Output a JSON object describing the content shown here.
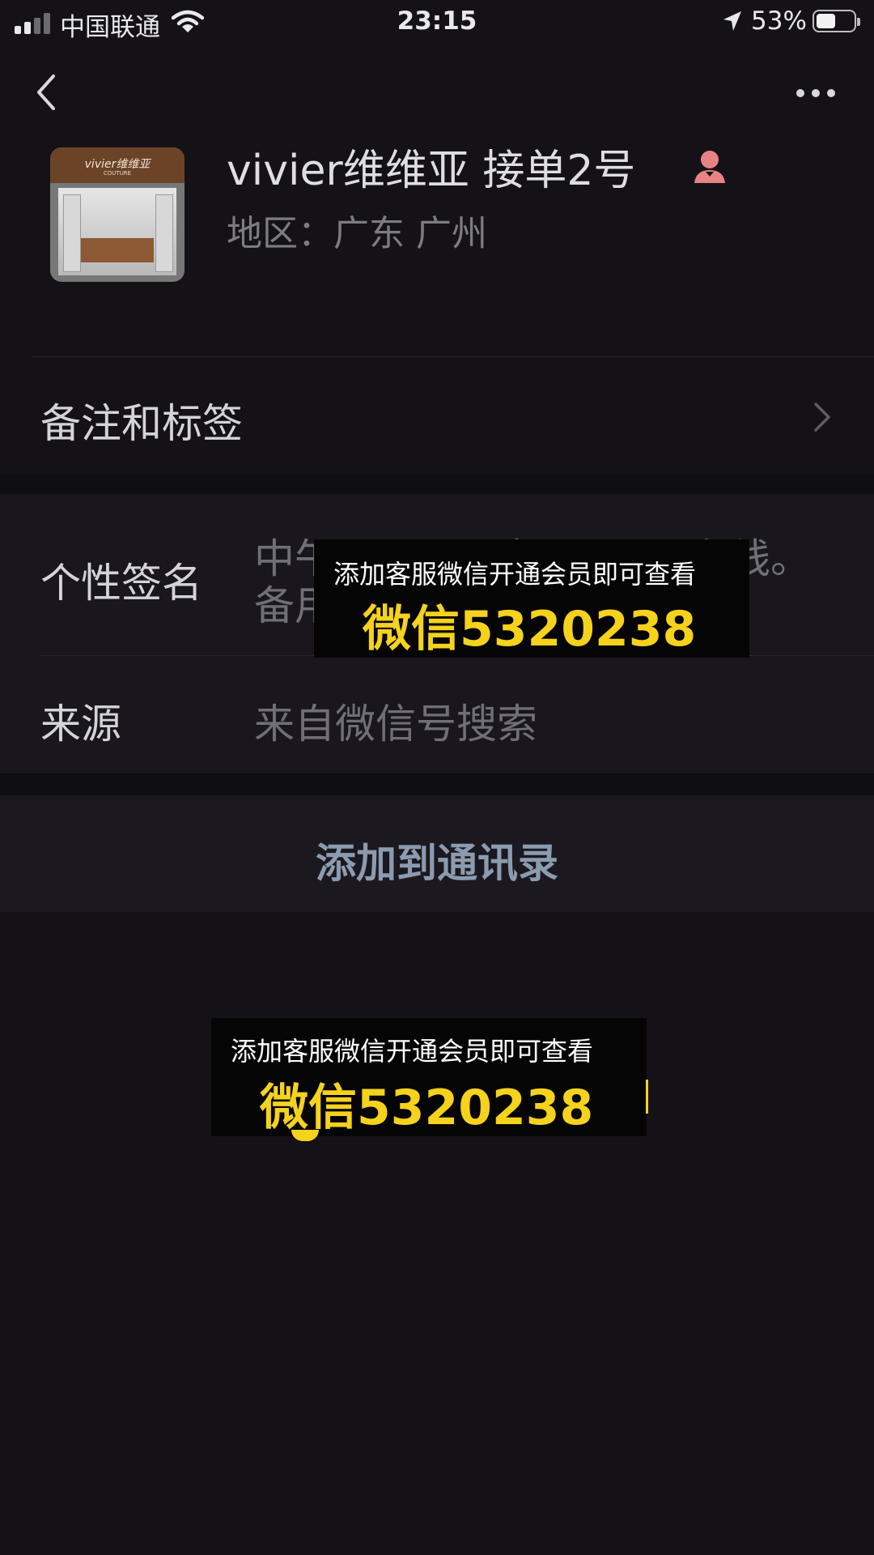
{
  "status_bar": {
    "carrier": "中国联通",
    "time": "23:15",
    "battery_percent": "53%",
    "battery_level": 0.53,
    "signal_bars_active": 2,
    "signal_bars_total": 4
  },
  "nav": {
    "back_icon": "chevron-left-icon",
    "more_icon": "ellipsis-icon"
  },
  "profile": {
    "avatar_logo_text": "vivier维维亚",
    "avatar_sub_text": "COUTURE",
    "name": "vivier维维亚 接单2号",
    "gender_icon": "female-icon",
    "region": "地区：广东 广州"
  },
  "rows": {
    "remarks_label": "备注和标签",
    "signature_label": "个性签名",
    "signature_value_line1": "中午12:00 - 凌晨02:00在线。",
    "signature_value_line2": "备用",
    "source_label": "来源",
    "source_value": "来自微信号搜索"
  },
  "add_to_contacts": "添加到通讯录",
  "overlays": [
    {
      "line1": "添加客服微信开通会员即可查看",
      "line2": "微信5320238"
    },
    {
      "line1": "添加客服微信开通会员即可查看",
      "line2": "微信5320238"
    }
  ],
  "colors": {
    "background": "#141217",
    "overlay_accent": "#f5d21c",
    "link_text": "#8b9bb0",
    "gender_icon": "#e98383"
  }
}
